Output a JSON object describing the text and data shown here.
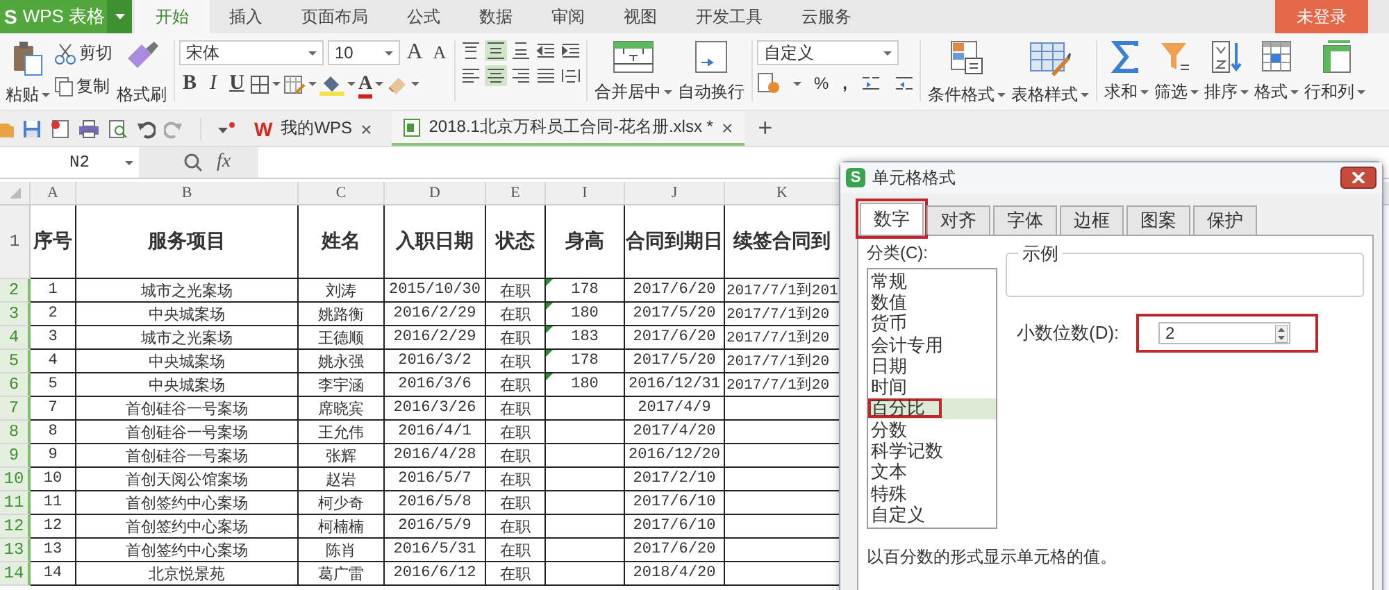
{
  "app": {
    "logo_mark": "S",
    "logo_text": "WPS 表格",
    "login_button": "未登录"
  },
  "menu_tabs": [
    {
      "label": "开始",
      "selected": true
    },
    {
      "label": "插入",
      "selected": false
    },
    {
      "label": "页面布局",
      "selected": false
    },
    {
      "label": "公式",
      "selected": false
    },
    {
      "label": "数据",
      "selected": false
    },
    {
      "label": "审阅",
      "selected": false
    },
    {
      "label": "视图",
      "selected": false
    },
    {
      "label": "开发工具",
      "selected": false
    },
    {
      "label": "云服务",
      "selected": false
    }
  ],
  "ribbon": {
    "clipboard": {
      "paste": "粘贴",
      "cut": "剪切",
      "copy": "复制",
      "format_painter": "格式刷"
    },
    "font": {
      "family": "宋体",
      "size": "10",
      "grow": "A",
      "shrink": "A",
      "bold": "B",
      "italic": "I",
      "underline": "U",
      "font_color": "A"
    },
    "alignment": {
      "buttons": [
        {
          "kind": "top",
          "selected": false
        },
        {
          "kind": "middle",
          "selected": true
        },
        {
          "kind": "bottom",
          "selected": false
        },
        {
          "kind": "indent-less",
          "selected": false
        },
        {
          "kind": "indent-more",
          "selected": false
        },
        {
          "kind": "left",
          "selected": false
        },
        {
          "kind": "center",
          "selected": true
        },
        {
          "kind": "right",
          "selected": false
        },
        {
          "kind": "justify",
          "selected": false
        },
        {
          "kind": "distributed",
          "selected": false
        }
      ],
      "merge": "合并居中",
      "wrap": "自动换行"
    },
    "number": {
      "format": "自定义",
      "percent": "%",
      "comma": ","
    },
    "styles": [
      {
        "kind": "conditional",
        "label": "条件格式"
      },
      {
        "kind": "table-style",
        "label": "表格样式"
      }
    ],
    "editing": [
      {
        "kind": "sum",
        "label": "求和"
      },
      {
        "kind": "filter",
        "label": "筛选"
      },
      {
        "kind": "sort",
        "label": "排序"
      },
      {
        "kind": "format",
        "label": "格式"
      },
      {
        "kind": "rows-columns",
        "label": "行和列"
      }
    ]
  },
  "doc_tabs": [
    {
      "logo": "W",
      "label": "我的WPS",
      "close": "×",
      "selected": false
    },
    {
      "label": "2018.1北京万科员工合同-花名册.xlsx *",
      "close": "×",
      "selected": true
    }
  ],
  "new_tab": "+",
  "formula_bar": {
    "name_box": "N2",
    "fx": "fx"
  },
  "sheet": {
    "columns": [
      "A",
      "B",
      "C",
      "D",
      "E",
      "I",
      "J",
      "K"
    ],
    "header_row": {
      "number": "1",
      "cells": [
        "序号",
        "服务项目",
        "姓名",
        "入职日期",
        "状态",
        "身高",
        "合同到期日",
        "续签合同到"
      ]
    },
    "rows": [
      {
        "number": "2",
        "selected": true,
        "flag": true,
        "cells": [
          "1",
          "城市之光案场",
          "刘涛",
          "2015/10/30",
          "在职",
          "178",
          "2017/6/20",
          "2017/7/1到201"
        ]
      },
      {
        "number": "3",
        "selected": true,
        "flag": true,
        "cells": [
          "2",
          "中央城案场",
          "姚路衡",
          "2016/2/29",
          "在职",
          "180",
          "2017/5/20",
          "2017/7/1到20"
        ]
      },
      {
        "number": "4",
        "selected": true,
        "flag": true,
        "cells": [
          "3",
          "城市之光案场",
          "王德顺",
          "2016/2/29",
          "在职",
          "183",
          "2017/6/20",
          "2017/7/1到20"
        ]
      },
      {
        "number": "5",
        "selected": true,
        "flag": true,
        "cells": [
          "4",
          "中央城案场",
          "姚永强",
          "2016/3/2",
          "在职",
          "178",
          "2017/5/20",
          "2017/7/1到20"
        ]
      },
      {
        "number": "6",
        "selected": true,
        "flag": true,
        "cells": [
          "5",
          "中央城案场",
          "李宇涵",
          "2016/3/6",
          "在职",
          "180",
          "2016/12/31",
          "2017/7/1到20"
        ]
      },
      {
        "number": "7",
        "selected": true,
        "flag": false,
        "cells": [
          "7",
          "首创硅谷一号案场",
          "席晓宾",
          "2016/3/26",
          "在职",
          null,
          "2017/4/9",
          null
        ]
      },
      {
        "number": "8",
        "selected": true,
        "flag": false,
        "cells": [
          "8",
          "首创硅谷一号案场",
          "王允伟",
          "2016/4/1",
          "在职",
          null,
          "2017/4/20",
          null
        ]
      },
      {
        "number": "9",
        "selected": true,
        "flag": false,
        "cells": [
          "9",
          "首创硅谷一号案场",
          "张辉",
          "2016/4/28",
          "在职",
          null,
          "2016/12/20",
          null
        ]
      },
      {
        "number": "10",
        "selected": true,
        "flag": false,
        "cells": [
          "10",
          "首创天阅公馆案场",
          "赵岩",
          "2016/5/7",
          "在职",
          null,
          "2017/2/10",
          null
        ]
      },
      {
        "number": "11",
        "selected": true,
        "flag": false,
        "cells": [
          "11",
          "首创签约中心案场",
          "柯少奇",
          "2016/5/8",
          "在职",
          null,
          "2017/6/10",
          null
        ]
      },
      {
        "number": "12",
        "selected": true,
        "flag": false,
        "cells": [
          "12",
          "首创签约中心案场",
          "柯楠楠",
          "2016/5/9",
          "在职",
          null,
          "2017/6/10",
          null
        ]
      },
      {
        "number": "13",
        "selected": true,
        "flag": false,
        "cells": [
          "13",
          "首创签约中心案场",
          "陈肖",
          "2016/5/31",
          "在职",
          null,
          "2017/6/20",
          null
        ]
      },
      {
        "number": "14",
        "selected": true,
        "flag": false,
        "cells": [
          "14",
          "北京悦景苑",
          "葛广雷",
          "2016/6/12",
          "在职",
          null,
          "2018/4/20",
          null
        ]
      }
    ]
  },
  "dialog": {
    "icon": "S",
    "title": "单元格格式",
    "tabs": [
      {
        "label": "数字",
        "selected": true,
        "highlighted": true
      },
      {
        "label": "对齐",
        "selected": false,
        "highlighted": false
      },
      {
        "label": "字体",
        "selected": false,
        "highlighted": false
      },
      {
        "label": "边框",
        "selected": false,
        "highlighted": false
      },
      {
        "label": "图案",
        "selected": false,
        "highlighted": false
      },
      {
        "label": "保护",
        "selected": false,
        "highlighted": false
      }
    ],
    "category_label": "分类(C):",
    "categories": [
      {
        "label": "常规",
        "selected": false,
        "highlighted": false
      },
      {
        "label": "数值",
        "selected": false,
        "highlighted": false
      },
      {
        "label": "货币",
        "selected": false,
        "highlighted": false
      },
      {
        "label": "会计专用",
        "selected": false,
        "highlighted": false
      },
      {
        "label": "日期",
        "selected": false,
        "highlighted": false
      },
      {
        "label": "时间",
        "selected": false,
        "highlighted": false
      },
      {
        "label": "百分比",
        "selected": true,
        "highlighted": true
      },
      {
        "label": "分数",
        "selected": false,
        "highlighted": false
      },
      {
        "label": "科学记数",
        "selected": false,
        "highlighted": false
      },
      {
        "label": "文本",
        "selected": false,
        "highlighted": false
      },
      {
        "label": "特殊",
        "selected": false,
        "highlighted": false
      },
      {
        "label": "自定义",
        "selected": false,
        "highlighted": false
      }
    ],
    "sample_label": "示例",
    "decimal_label": "小数位数(D):",
    "decimal_value": "2",
    "decimal_highlighted": true,
    "description": "以百分数的形式显示单元格的值。"
  }
}
